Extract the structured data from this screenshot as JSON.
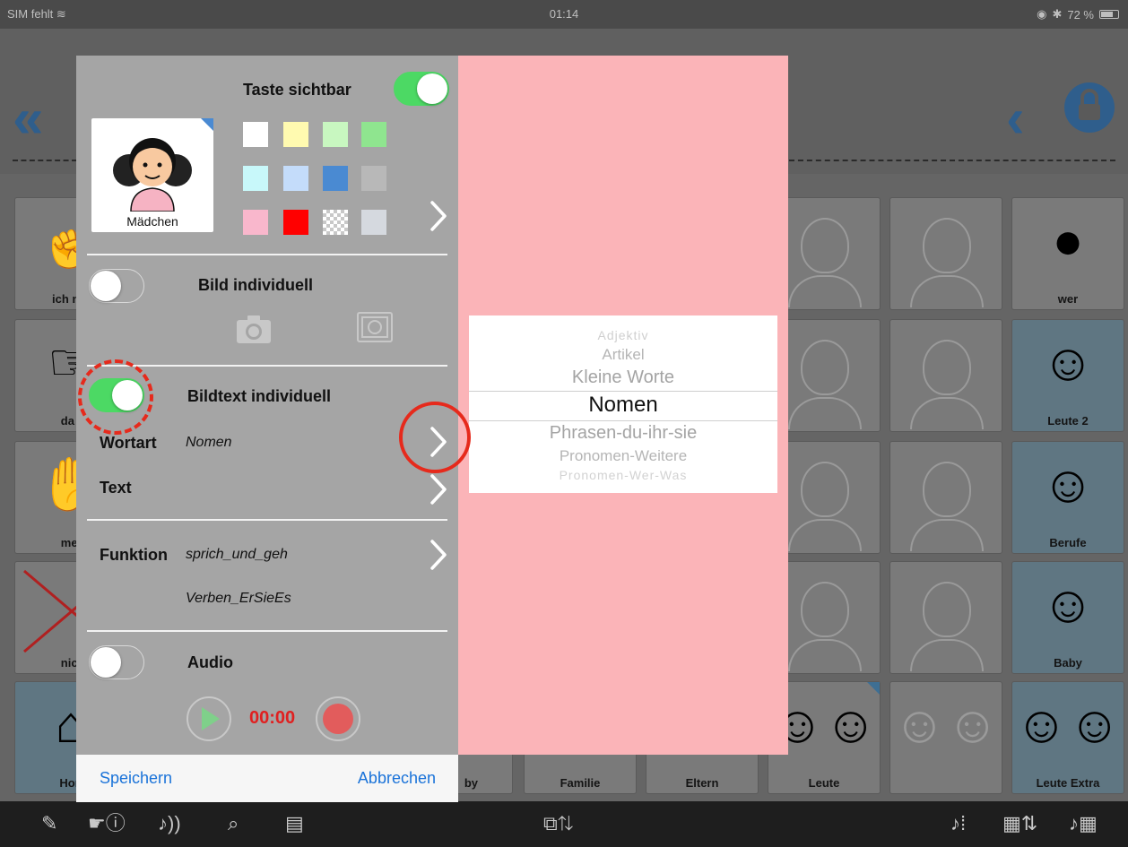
{
  "status_bar": {
    "carrier": "SIM fehlt",
    "time": "01:14",
    "battery": "72 %"
  },
  "grid": {
    "labels": {
      "r0c0": "ich mö",
      "r1c0": "da i",
      "r2c0": "mel",
      "r3c0": "nicl",
      "r4c0": "Hon",
      "r4c3": "by",
      "r4c4": "Familie",
      "r4c5": "Eltern",
      "r4c6": "Leute",
      "r0c8": "wer",
      "r1c8": "Leute 2",
      "r2c8": "Berufe",
      "r3c8": "Baby",
      "r4c8": "Leute Extra"
    }
  },
  "panel": {
    "key_visible_label": "Taste sichtbar",
    "key_visible_on": true,
    "thumbnail_caption": "Mädchen",
    "swatch_colors": [
      "#ffffff",
      "#fffab0",
      "#c8f7c0",
      "#8fe58f",
      "#c8f8fa",
      "#c4dcfa",
      "#4a8ad2",
      "#b8b8b8",
      "#f9b7cc",
      "#ff0000",
      "checkered",
      "#d5d9df"
    ],
    "bild_individuell_label": "Bild individuell",
    "bild_individuell_on": false,
    "bildtext_individuell_label": "Bildtext individuell",
    "bildtext_individuell_on": true,
    "wortart_label": "Wortart",
    "wortart_value": "Nomen",
    "text_label": "Text",
    "funktion_label": "Funktion",
    "funktion_value_1": "sprich_und_geh",
    "funktion_value_2": "Verben_ErSieEs",
    "audio_label": "Audio",
    "audio_on": false,
    "audio_time": "00:00",
    "save_label": "Speichern",
    "cancel_label": "Abbrechen"
  },
  "picker": {
    "items": [
      "Adjektiv",
      "Artikel",
      "Kleine Worte",
      "Nomen",
      "Phrasen-du-ihr-sie",
      "Pronomen-Weitere",
      "Pronomen-Wer-Was"
    ],
    "selected": "Nomen"
  },
  "colors": {
    "toggle_on": "#4cd964",
    "accent_blue": "#1a73d9",
    "annotation_red": "#e62a1c",
    "timer_red": "#e02020",
    "picker_background": "#fbb4b8"
  }
}
